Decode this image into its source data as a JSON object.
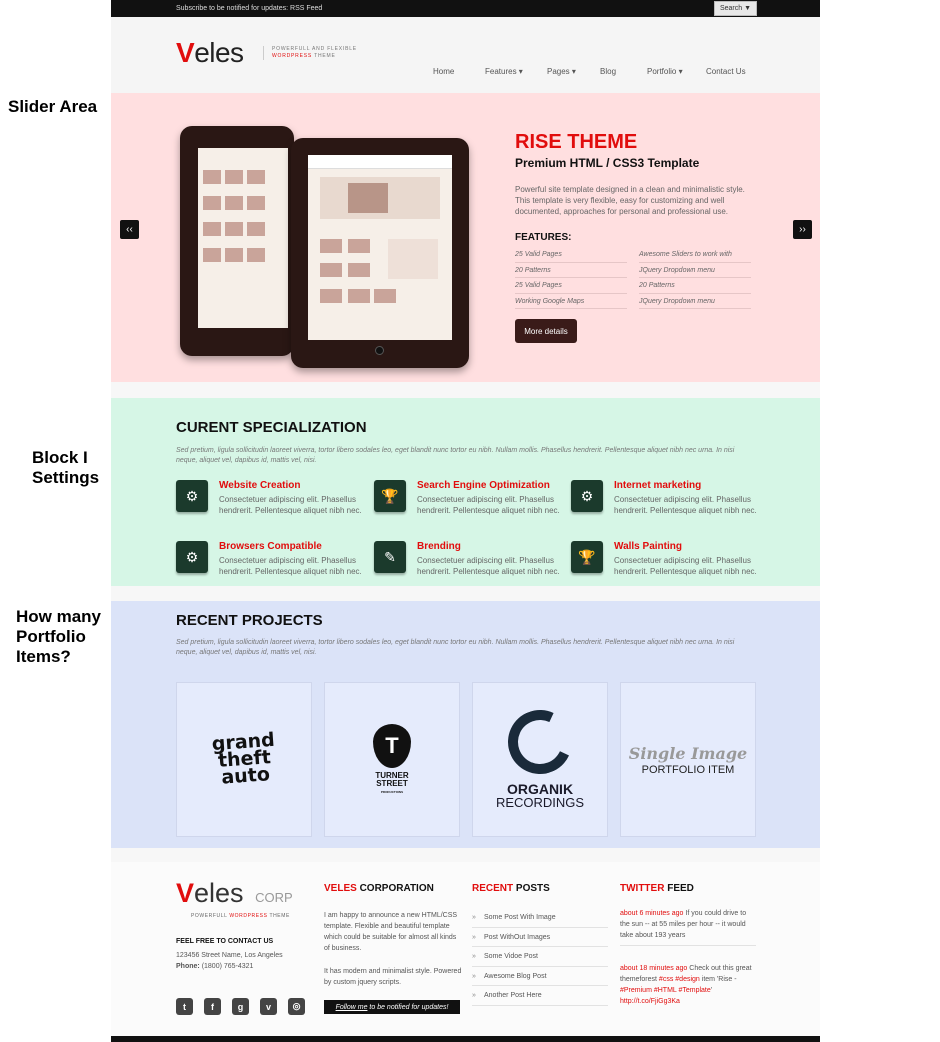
{
  "annotations": {
    "slider": "Slider Area",
    "block": "Block I Settings",
    "portfolio": "How many Portfolio Items?"
  },
  "topbar": {
    "subscribe": "Subscribe to be notified for updates: RSS Feed",
    "search": "Search ▼"
  },
  "logo": {
    "v": "V",
    "rest": "eles",
    "tagline_line1": "POWERFULL AND FLEXIBLE",
    "tagline_red": "WORDPRESS",
    "tagline_end": "THEME"
  },
  "nav": {
    "items": [
      "Home",
      "Features ▾",
      "Pages ▾",
      "Blog",
      "Portfolio ▾",
      "Contact Us"
    ]
  },
  "slider": {
    "prev": "‹‹",
    "next": "››",
    "title": "RISE THEME",
    "subtitle": "Premium HTML / CSS3 Template",
    "desc": "Powerful site template designed in a clean and minimalistic style. This template is very flexible, easy for customizing and well documented, approaches for personal and professional use.",
    "features_title": "FEATURES:",
    "features_left": [
      "25 Valid Pages",
      "20 Patterns",
      "25 Valid Pages",
      "Working Google Maps"
    ],
    "features_right": [
      "Awesome Sliders to work with",
      "JQuery Dropdown menu",
      "20 Patterns",
      "JQuery Dropdown menu"
    ],
    "button": "More details"
  },
  "specialization": {
    "title": "CURENT SPECIALIZATION",
    "desc": "Sed pretium, ligula sollicitudin laoreet viverra, tortor libero sodales leo, eget blandit nunc tortor eu nibh. Nullam mollis. Phasellus hendrerit. Pellentesque aliquet nibh nec urna. In nisi neque, aliquet vel, dapibus id, mattis vel, nisi.",
    "services": [
      {
        "title": "Website Creation",
        "desc": "Consectetuer adipiscing elit. Phasellus hendrerit. Pellentesque aliquet nibh nec.",
        "icon": "gear-icon"
      },
      {
        "title": "Search Engine Optimization",
        "desc": "Consectetuer adipiscing elit. Phasellus hendrerit. Pellentesque aliquet nibh nec.",
        "icon": "trophy-icon"
      },
      {
        "title": "Internet marketing",
        "desc": "Consectetuer adipiscing elit. Phasellus hendrerit. Pellentesque aliquet nibh nec.",
        "icon": "gear-icon"
      },
      {
        "title": "Browsers Compatible",
        "desc": "Consectetuer adipiscing elit. Phasellus hendrerit. Pellentesque aliquet nibh nec.",
        "icon": "gear-icon"
      },
      {
        "title": "Brending",
        "desc": "Consectetuer adipiscing elit. Phasellus hendrerit. Pellentesque aliquet nibh nec.",
        "icon": "document-icon"
      },
      {
        "title": "Walls Painting",
        "desc": "Consectetuer adipiscing elit. Phasellus hendrerit. Pellentesque aliquet nibh nec.",
        "icon": "trophy-icon"
      }
    ]
  },
  "projects": {
    "title": "RECENT PROJECTS",
    "desc": "Sed pretium, ligula sollicitudin laoreet viverra, tortor libero sodales leo, eget blandit nunc tortor eu nibh. Nullam mollis. Phasellus hendrerit. Pellentesque aliquet nibh nec urna. In nisi neque, aliquet vel, dapibus id, mattis vel, nisi.",
    "items": [
      {
        "line1": "grand",
        "line2": "theft",
        "line3": "auto"
      },
      {
        "badge": "T",
        "line1": "TURNER",
        "line2": "STREET",
        "line3": "PRODUCTIONS"
      },
      {
        "line1": "ORGANIK",
        "line2": "RECORDINGS"
      },
      {
        "line1": "Single Image",
        "line2": "PORTFOLIO ITEM"
      }
    ]
  },
  "footer": {
    "logo_v": "V",
    "logo_rest": "eles",
    "logo_corp": "CORP",
    "tagline": "POWERFULL",
    "tagline_red": "WORDPRESS",
    "tagline_end": "THEME",
    "contact_title": "FEEL FREE TO CONTACT US",
    "address": "123456 Street Name, Los Angeles",
    "phone_label": "Phone:",
    "phone": "(1800) 765-4321",
    "corp_title_red": "VELES",
    "corp_title": "CORPORATION",
    "corp_text1": "I am happy to announce a new HTML/CSS template. Flexible and beautiful template which could be suitable for almost all kinds of business.",
    "corp_text2": "It has modern and minimalist style. Powered by custom jquery scripts.",
    "follow_link": "Follow me",
    "follow_rest": "to be notified for updates!",
    "posts_title_red": "RECENT",
    "posts_title": "POSTS",
    "posts": [
      "Some Post With Image",
      "Post WithOut Images",
      "Some Vidoe Post",
      "Awesome Blog Post",
      "Another Post Here"
    ],
    "twitter_title_red": "TWITTER",
    "twitter_title": "FEED",
    "tweets": [
      {
        "time": "about 6 minutes ago",
        "text": "If you could drive to the sun -- at 55 miles per hour -- it would take about 193 years"
      },
      {
        "time": "about 18 minutes ago",
        "text": "Check out this great themeforest",
        "tag1": "#css",
        "tag2": "#design",
        "text2": "item 'Rise -",
        "tag3": "#Premium #HTML #Template",
        "text3": "'",
        "link": "http://t.co/FjiGg3Ka"
      }
    ],
    "social": [
      "t",
      "f",
      "g",
      "v",
      "◎"
    ]
  }
}
